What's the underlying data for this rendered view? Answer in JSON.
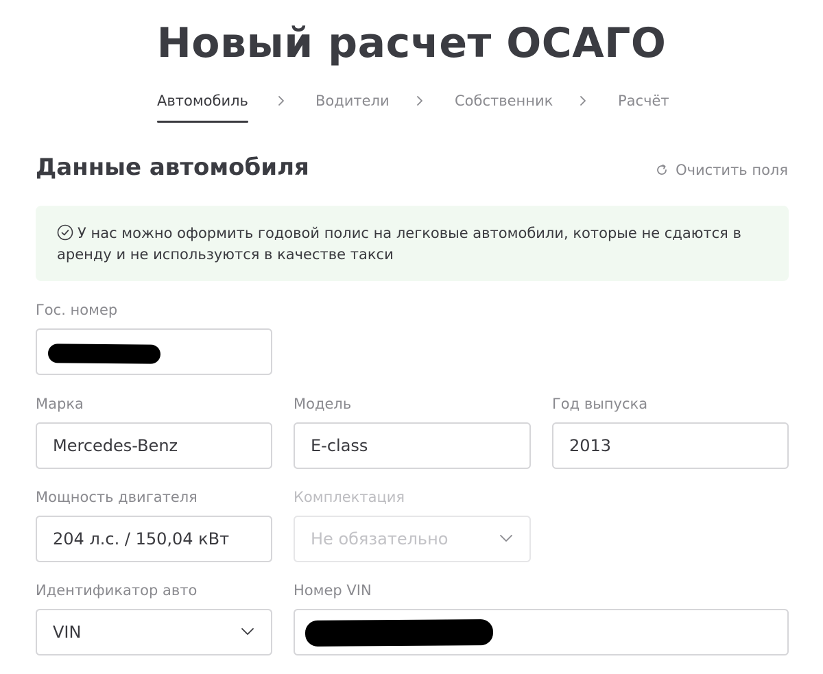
{
  "page": {
    "title": "Новый расчет ОСАГО"
  },
  "steps": [
    {
      "label": "Автомобиль",
      "active": true
    },
    {
      "label": "Водители",
      "active": false
    },
    {
      "label": "Собственник",
      "active": false
    },
    {
      "label": "Расчёт",
      "active": false
    }
  ],
  "section": {
    "title": "Данные автомобиля",
    "clear_label": "Очистить поля"
  },
  "notice": {
    "text": "У нас можно оформить годовой полис на легковые автомобили, которые не сдаются в аренду и не используются в качестве такси"
  },
  "form": {
    "plate": {
      "label": "Гос. номер",
      "value": ""
    },
    "brand": {
      "label": "Марка",
      "value": "Mercedes-Benz"
    },
    "model": {
      "label": "Модель",
      "value": "E-class"
    },
    "year": {
      "label": "Год выпуска",
      "value": "2013"
    },
    "power": {
      "label": "Мощность двигателя",
      "value": "204 л.с. / 150,04 кВт"
    },
    "trim": {
      "label": "Комплектация",
      "placeholder": "Не обязательно"
    },
    "id_type": {
      "label": "Идентификатор авто",
      "value": "VIN"
    },
    "vin": {
      "label": "Номер VIN",
      "value": ""
    }
  },
  "icons": {
    "refresh": "refresh-icon",
    "check": "check-circle-icon",
    "chevron": "chevron-down-icon",
    "step_separator": "chevron-right-icon"
  },
  "colors": {
    "text": "#3a3a3f",
    "muted": "#8a8a8f",
    "notice_bg": "#f1f9f1",
    "border": "#d6d6d9"
  }
}
